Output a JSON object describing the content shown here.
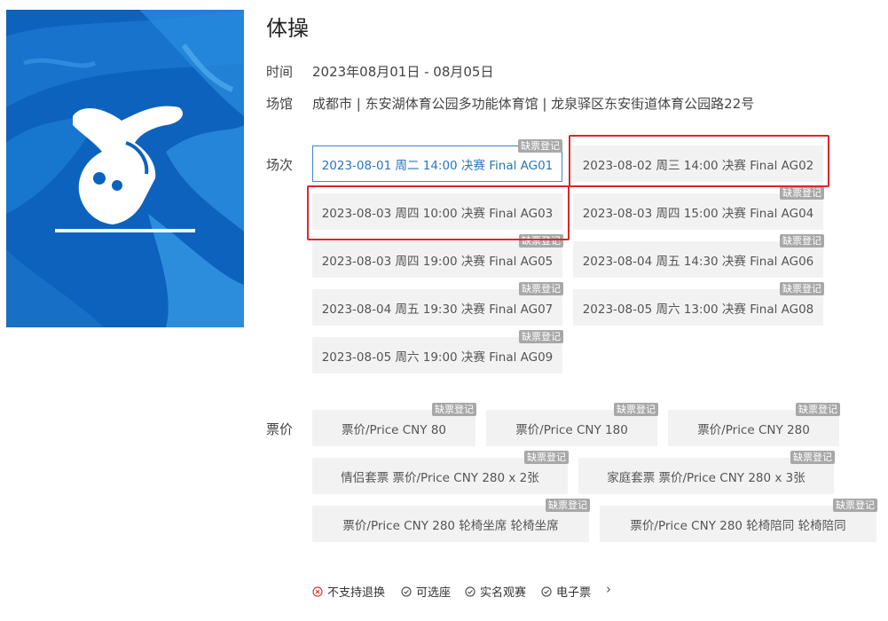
{
  "event": {
    "title": "体操",
    "time_label": "时间",
    "time_value": "2023年08月01日 - 08月05日",
    "venue_label": "场馆",
    "venue_value": "成都市 | 东安湖体育公园多功能体育馆 | 龙泉驿区东安街道体育公园路22号"
  },
  "sessions_label": "场次",
  "sessions": [
    {
      "label": "2023-08-01 周二 14:00 决赛 Final AG01",
      "badge": "缺票登记",
      "selected": true
    },
    {
      "label": "2023-08-02 周三 14:00 决赛 Final AG02",
      "badge": "",
      "selected": false
    },
    {
      "label": "2023-08-03 周四 10:00 决赛 Final AG03",
      "badge": "",
      "selected": false
    },
    {
      "label": "2023-08-03 周四 15:00 决赛 Final AG04",
      "badge": "缺票登记",
      "selected": false
    },
    {
      "label": "2023-08-03 周四 19:00 决赛 Final AG05",
      "badge": "缺票登记",
      "selected": false
    },
    {
      "label": "2023-08-04 周五 14:30 决赛 Final AG06",
      "badge": "缺票登记",
      "selected": false
    },
    {
      "label": "2023-08-04 周五 19:30 决赛 Final AG07",
      "badge": "缺票登记",
      "selected": false
    },
    {
      "label": "2023-08-05 周六 13:00 决赛 Final AG08",
      "badge": "缺票登记",
      "selected": false
    },
    {
      "label": "2023-08-05 周六 19:00 决赛 Final AG09",
      "badge": "缺票登记",
      "selected": false
    }
  ],
  "prices_label": "票价",
  "prices": [
    {
      "label": "票价/Price CNY 80",
      "badge": "缺票登记"
    },
    {
      "label": "票价/Price CNY 180",
      "badge": "缺票登记"
    },
    {
      "label": "票价/Price CNY 280",
      "badge": "缺票登记"
    },
    {
      "label": "情侣套票 票价/Price CNY 280 x 2张",
      "badge": "缺票登记"
    },
    {
      "label": "家庭套票 票价/Price CNY 280 x 3张",
      "badge": "缺票登记"
    },
    {
      "label": "票价/Price CNY 280 轮椅坐席 轮椅坐席",
      "badge": "缺票登记"
    },
    {
      "label": "票价/Price CNY 280 轮椅陪同 轮椅陪同",
      "badge": "缺票登记"
    }
  ],
  "policies": [
    {
      "label": "不支持退换",
      "icon": "x-circle-icon",
      "color": "#e03a3a"
    },
    {
      "label": "可选座",
      "icon": "check-circle-icon",
      "color": "#666666"
    },
    {
      "label": "实名观赛",
      "icon": "check-circle-icon",
      "color": "#666666"
    },
    {
      "label": "电子票",
      "icon": "check-circle-icon",
      "color": "#666666"
    }
  ],
  "colors": {
    "accent": "#3b86d4",
    "highlight": "#e02626",
    "poster_blue": "#0b5fb8",
    "badge_gray": "#a8a8a8"
  }
}
